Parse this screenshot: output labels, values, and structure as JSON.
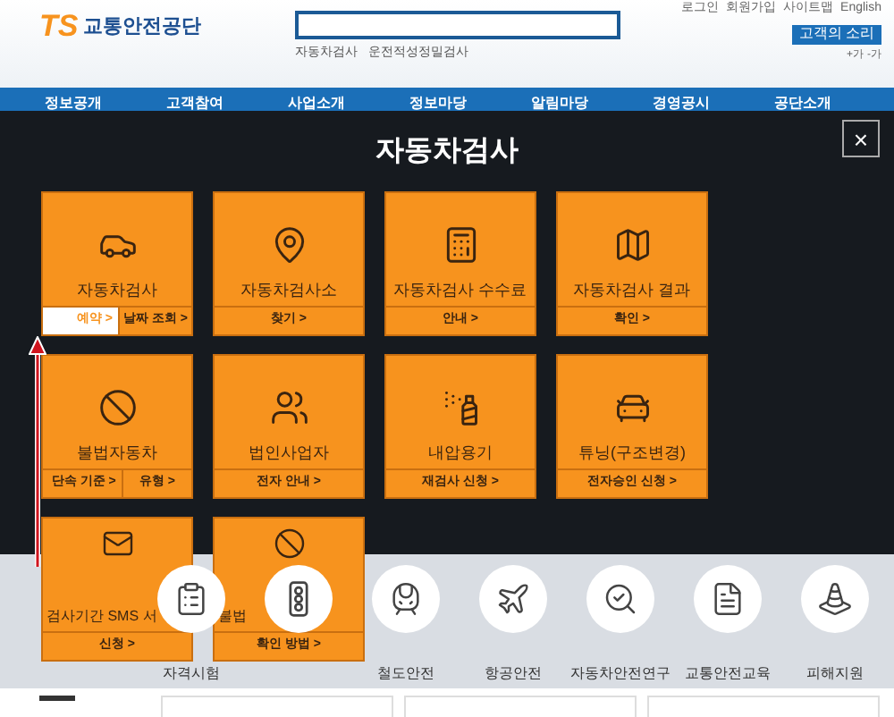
{
  "header": {
    "logo_mark": "TS",
    "logo_text": "교통안전공단",
    "quick_links": [
      "자동차검사",
      "운전적성정밀검사"
    ],
    "top_links": [
      "로그인",
      "회원가입",
      "사이트맵",
      "English"
    ],
    "voice_button": "고객의 소리",
    "font_size": [
      "+가",
      "-가"
    ]
  },
  "nav": [
    "정보공개",
    "고객참여",
    "사업소개",
    "정보마당",
    "알림마당",
    "경영공시",
    "공단소개"
  ],
  "modal": {
    "title": "자동차검사",
    "close": "×",
    "tiles": [
      {
        "kind": "car",
        "label": "자동차검사",
        "links": [
          {
            "text": "예약 >",
            "selected": true
          },
          {
            "text": "날짜 조회 >",
            "selected": false
          }
        ]
      },
      {
        "kind": "pin",
        "label": "자동차검사소",
        "links": [
          {
            "text": "찾기 >",
            "selected": false
          }
        ]
      },
      {
        "kind": "calc",
        "label": "자동차검사 수수료",
        "links": [
          {
            "text": "안내 >",
            "selected": false
          }
        ]
      },
      {
        "kind": "map",
        "label": "자동차검사 결과",
        "links": [
          {
            "text": "확인 >",
            "selected": false
          }
        ]
      },
      {
        "kind": "ban",
        "label": "불법자동차",
        "links": [
          {
            "text": "단속 기준 >",
            "selected": false
          },
          {
            "text": "유형 >",
            "selected": false
          }
        ]
      },
      {
        "kind": "people",
        "label": "법인사업자",
        "links": [
          {
            "text": "전자 안내 >",
            "selected": false
          }
        ]
      },
      {
        "kind": "tank",
        "label": "내압용기",
        "links": [
          {
            "text": "재검사 신청 >",
            "selected": false
          }
        ]
      },
      {
        "kind": "tuning",
        "label": "튜닝(구조변경)",
        "links": [
          {
            "text": "전자승인 신청 >",
            "selected": false
          }
        ]
      },
      {
        "kind": "sms",
        "label": "검사기간 SMS 서",
        "links": [
          {
            "text": "신청 >",
            "selected": false
          }
        ]
      },
      {
        "kind": "ban",
        "label": "불법",
        "links": [
          {
            "text": "확인 방법 >",
            "selected": false
          }
        ]
      }
    ]
  },
  "services": [
    {
      "kind": "checklist",
      "label": "자격시험"
    },
    {
      "kind": "traffic"
    },
    {
      "kind": "train",
      "label": "철도안전"
    },
    {
      "kind": "plane",
      "label": "항공안전"
    },
    {
      "kind": "carsearch",
      "label": "자동차안전연구"
    },
    {
      "kind": "doc",
      "label": "교통안전교육"
    },
    {
      "kind": "cone",
      "label": "피해지원"
    }
  ]
}
